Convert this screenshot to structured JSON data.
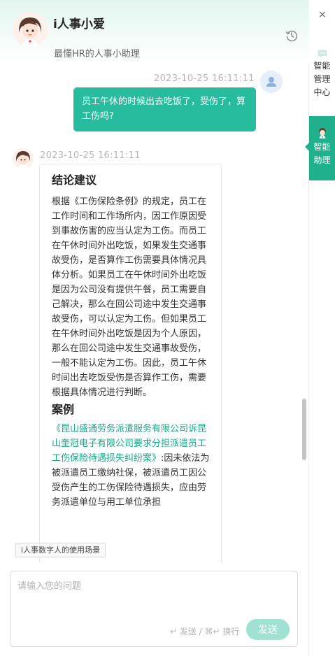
{
  "header": {
    "title": "i人事小爱",
    "subtitle": "最懂HR的人事小助理",
    "history_icon": "history-clock-icon"
  },
  "conversation": {
    "user_message": {
      "timestamp": "2023-10-25 16:11:11",
      "text": "员工午休的时候出去吃饭了，受伤了，算工伤吗?"
    },
    "bot_message": {
      "timestamp": "2023-10-25 16:11:11",
      "conclusion_heading": "结论建议",
      "conclusion_text": "根据《工伤保险条例》的规定，员工在工作时间和工作场所内，因工作原因受到事故伤害的应当认定为工伤。而员工在午休时间外出吃饭，如果发生交通事故受伤，是否算作工伤需要具体情况具体分析。如果员工在午休时间外出吃饭是因为公司没有提供午餐，员工需要自己解决，那么在回公司途中发生交通事故受伤，可以认定为工伤。但如果员工在午休时间外出吃饭是因为个人原因，那么在回公司途中发生交通事故受伤，一般不能认定为工伤。因此，员工午休时间出去吃饭受伤是否算作工伤，需要根据具体情况进行判断。",
      "case_heading": "案例",
      "case_link": "《昆山盛通劳务派遣服务有限公司诉昆山奎冠电子有限公司要求分担派遣员工工伤保险待遇损失纠纷案》",
      "case_text": ":因未依法为被派遣员工缴纳社保，被派遣员工因公受伤产生的工伤保险待遇损失，应由劳务派遣单位与用工单位承担"
    }
  },
  "usage_tag": "i人事数字人的使用场景",
  "input": {
    "placeholder": "请输入您的问题",
    "hint": "↵ 发送 / ⌘↵ 换行",
    "send_label": "发送"
  },
  "rail": {
    "close_label": "×",
    "items": [
      {
        "label": "智能管理中心",
        "icon": "chat-bubble-icon",
        "active": false
      },
      {
        "label": "智能助理",
        "icon": "assistant-avatar-icon",
        "active": true
      }
    ]
  },
  "colors": {
    "accent": "#27bc9e",
    "rail_active": "#21b08e",
    "link": "#1aa58a",
    "send_disabled": "#9fe1d2",
    "header_tint": "#e2f6ef"
  }
}
